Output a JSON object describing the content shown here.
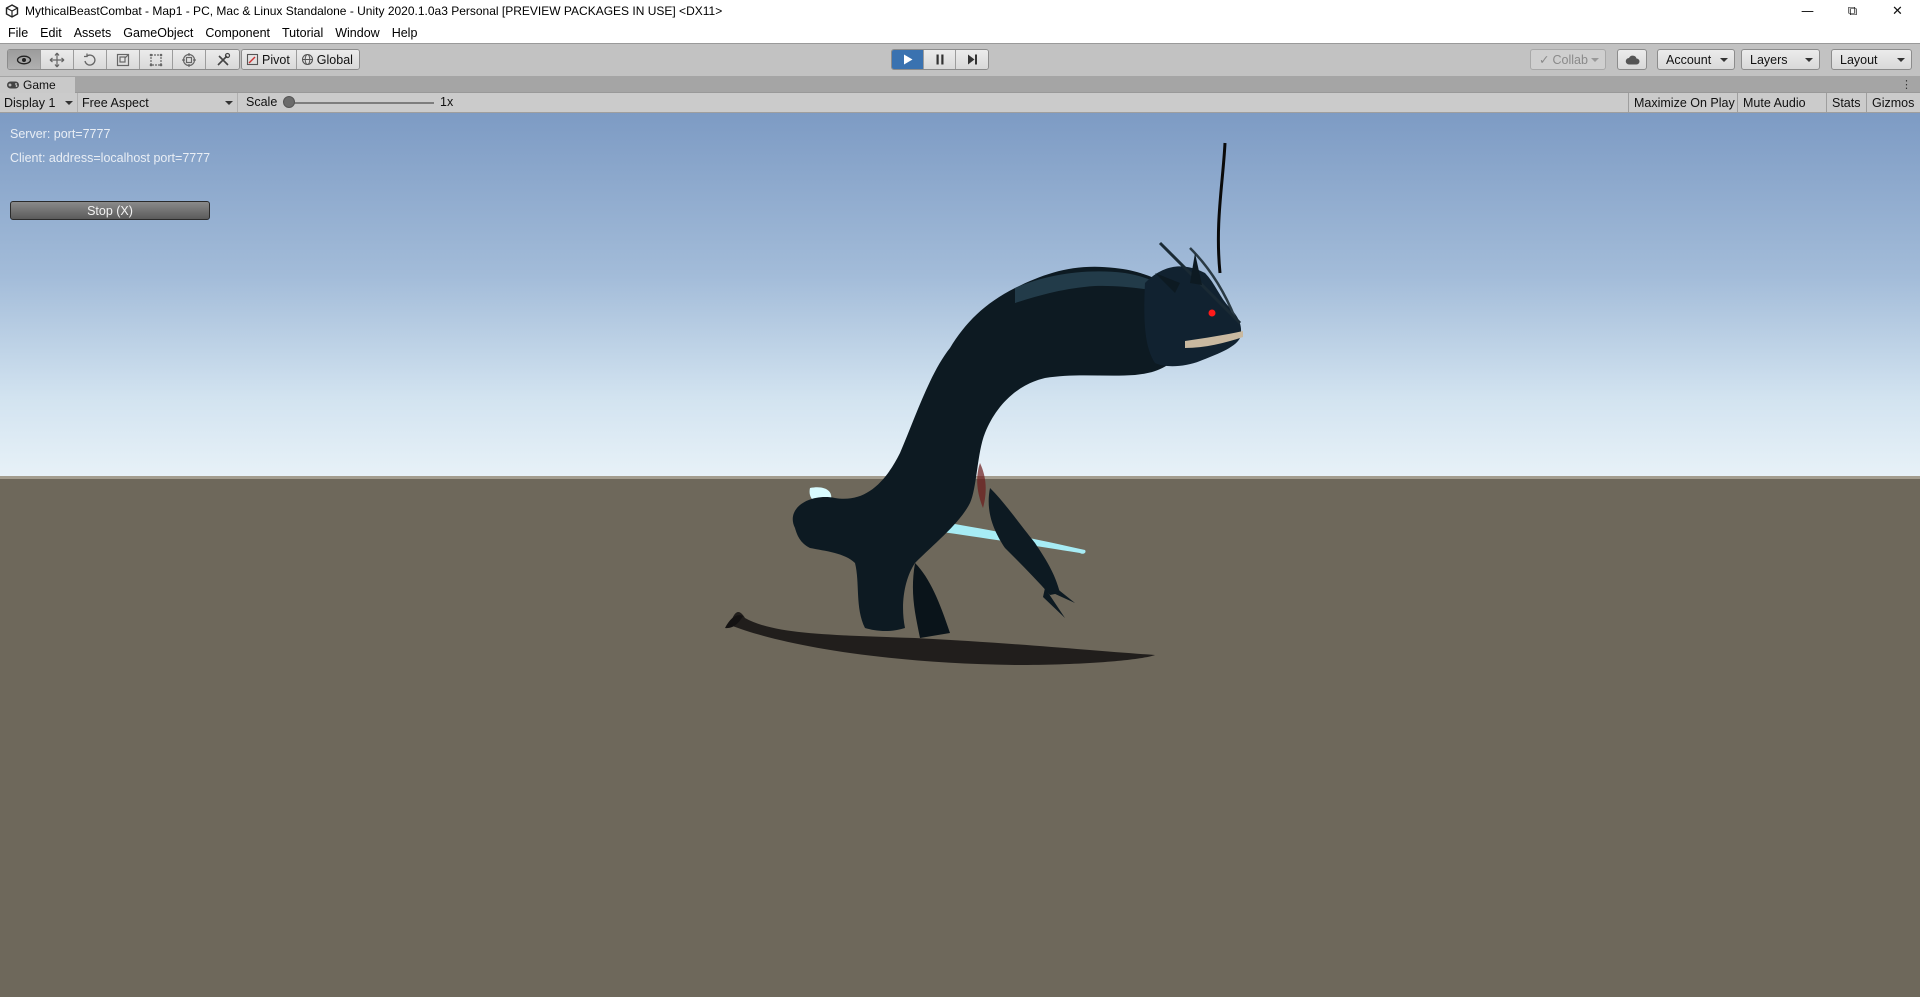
{
  "window": {
    "title": "MythicalBeastCombat - Map1 - PC, Mac & Linux Standalone - Unity 2020.1.0a3 Personal [PREVIEW PACKAGES IN USE] <DX11>",
    "minimize": "—",
    "restore": "⧉",
    "close": "✕"
  },
  "menu": [
    "File",
    "Edit",
    "Assets",
    "GameObject",
    "Component",
    "Tutorial",
    "Window",
    "Help"
  ],
  "toolbar": {
    "tools": [
      "view-hand-icon",
      "move-icon",
      "rotate-icon",
      "scale-icon",
      "rect-icon",
      "transform-icon",
      "custom-tool-icon"
    ],
    "pivot_label": "Pivot",
    "global_label": "Global",
    "collab_label": "Collab",
    "account_label": "Account",
    "layers_label": "Layers",
    "layout_label": "Layout",
    "play_state": "playing"
  },
  "game_tab": {
    "label": "Game"
  },
  "game_controls": {
    "display": "Display 1",
    "aspect": "Free Aspect",
    "scale_label": "Scale",
    "scale_value": "1x",
    "maximize_on_play": "Maximize On Play",
    "mute_audio": "Mute Audio",
    "stats": "Stats",
    "gizmos": "Gizmos"
  },
  "hud": {
    "server": "Server: port=7777",
    "client": "Client: address=localhost port=7777",
    "stop_button": "Stop (X)"
  },
  "colors": {
    "toolbar_bg": "#c2c2c2",
    "play_active": "#3a72b0",
    "ground": "#6e685b",
    "sky_top": "#7d9bc4",
    "creature_body": "#0d1a22",
    "creature_glow": "#9be9f5",
    "creature_eye": "#ff1a1a"
  }
}
